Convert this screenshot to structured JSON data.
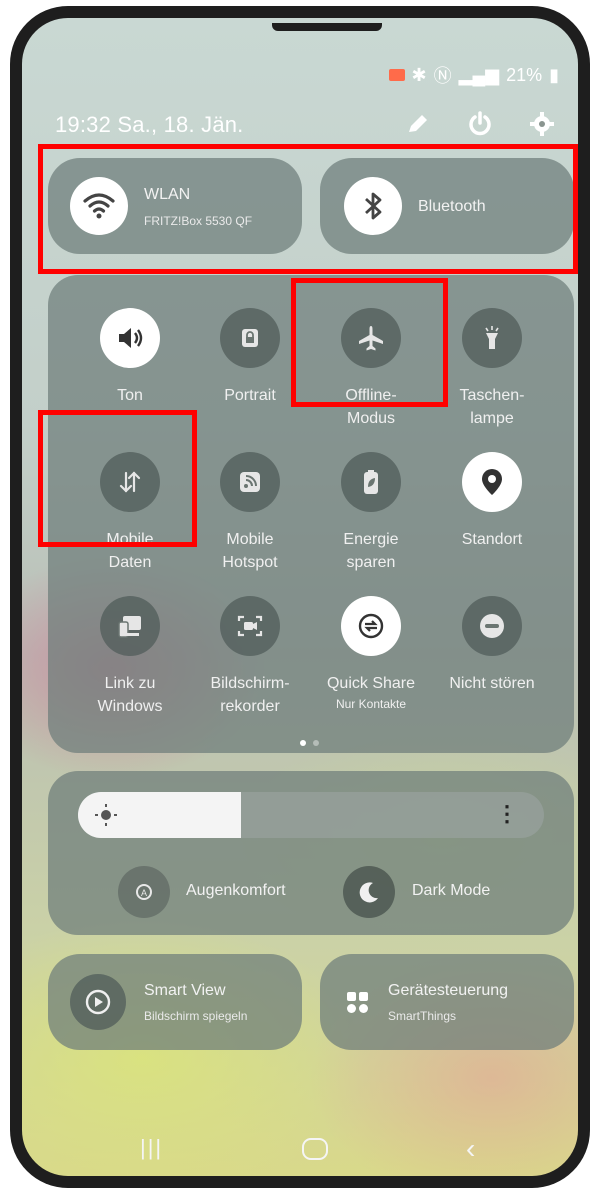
{
  "status": {
    "battery": "21%"
  },
  "header": {
    "time": "19:32",
    "date": "Sa., 18. Jän."
  },
  "wifi": {
    "label": "WLAN",
    "network": "FRITZ!Box 5530 QF"
  },
  "bluetooth": {
    "label": "Bluetooth"
  },
  "tiles": [
    {
      "name": "Ton",
      "state": "on",
      "icon": "speaker-icon"
    },
    {
      "name": "Portrait",
      "state": "off",
      "icon": "rotation-lock-icon"
    },
    {
      "name": "Offline-\nModus",
      "state": "off",
      "icon": "airplane-icon"
    },
    {
      "name": "Taschen-\nlampe",
      "state": "off",
      "icon": "flashlight-icon"
    },
    {
      "name": "Mobile\nDaten",
      "state": "off",
      "icon": "mobile-data-icon"
    },
    {
      "name": "Mobile\nHotspot",
      "state": "off",
      "icon": "hotspot-icon"
    },
    {
      "name": "Energie\nsparen",
      "state": "off",
      "icon": "battery-saver-icon"
    },
    {
      "name": "Standort",
      "state": "on",
      "icon": "location-pin-icon"
    },
    {
      "name": "Link zu\nWindows",
      "state": "off",
      "icon": "link-to-windows-icon"
    },
    {
      "name": "Bildschirm-\nrekorder",
      "state": "off",
      "icon": "screen-recorder-icon"
    },
    {
      "name": "Quick Share",
      "note": "Nur Kontakte",
      "state": "on",
      "icon": "quick-share-icon"
    },
    {
      "name": "Nicht stören",
      "state": "off",
      "icon": "do-not-disturb-icon"
    }
  ],
  "brightness": {
    "level": 0.35
  },
  "eye_comfort": {
    "label": "Augenkomfort"
  },
  "dark_mode": {
    "label": "Dark Mode"
  },
  "smart_view": {
    "label": "Smart View",
    "sub": "Bildschirm spiegeln"
  },
  "device_control": {
    "label": "Gerätesteuerung",
    "sub": "SmartThings"
  },
  "colors": {
    "accent_red": "#ff0000",
    "tile_bg": "#6e7d7a",
    "active": "#ffffff"
  }
}
